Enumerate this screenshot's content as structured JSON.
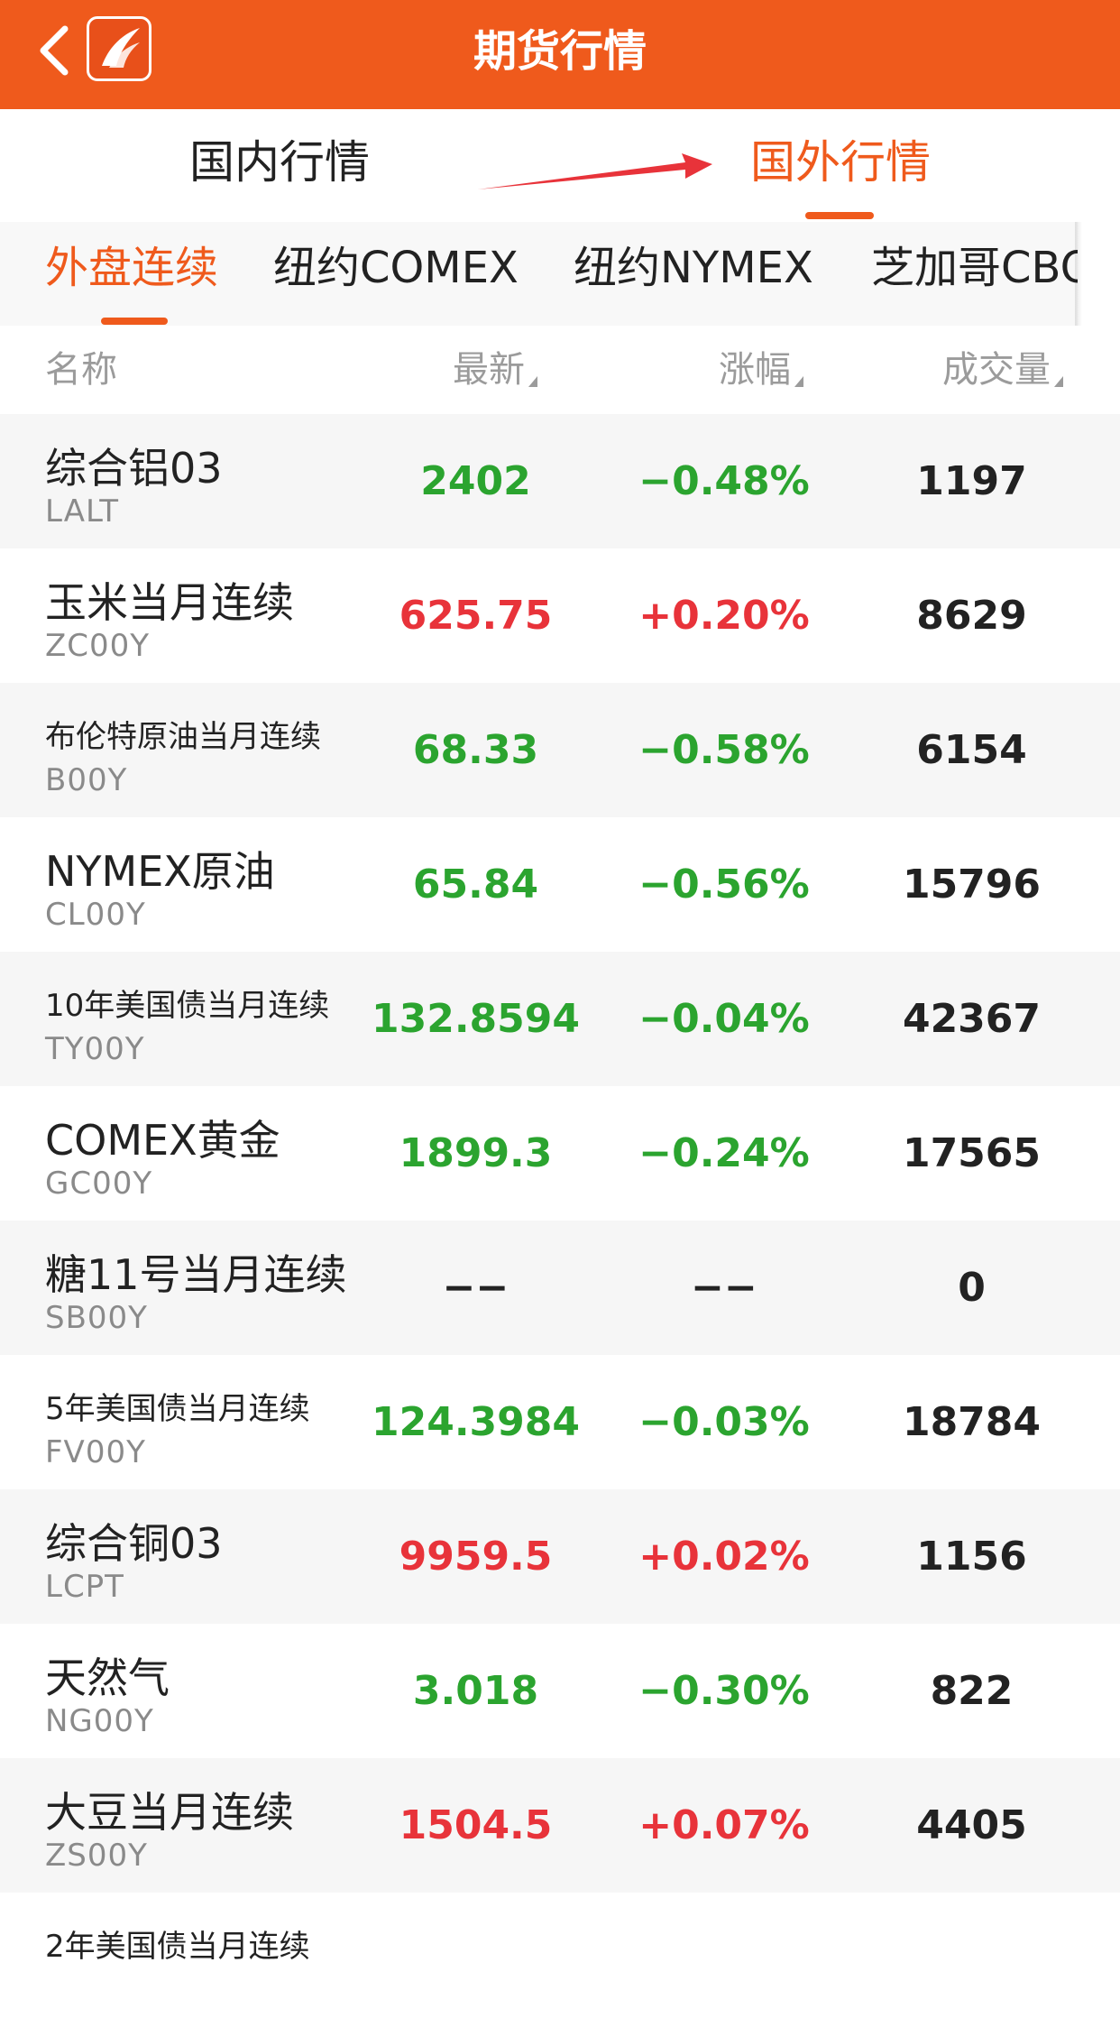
{
  "header": {
    "title": "期货行情"
  },
  "region_tabs": [
    {
      "label": "国内行情",
      "active": false
    },
    {
      "label": "国外行情",
      "active": true
    }
  ],
  "exchange_tabs": [
    {
      "label": "外盘连续",
      "active": true
    },
    {
      "label": "纽约COMEX",
      "active": false
    },
    {
      "label": "纽约NYMEX",
      "active": false
    },
    {
      "label": "芝加哥CBOT",
      "active": false
    }
  ],
  "columns": {
    "name": "名称",
    "latest": "最新",
    "change": "涨幅",
    "volume": "成交量"
  },
  "colors": {
    "accent": "#ef5a1c",
    "up": "#e8333a",
    "down": "#2ba42f"
  },
  "rows": [
    {
      "name": "综合铝03",
      "code": "LALT",
      "latest": "2402",
      "change": "−0.48%",
      "volume": "1197",
      "trend": "down"
    },
    {
      "name": "玉米当月连续",
      "code": "ZC00Y",
      "latest": "625.75",
      "change": "+0.20%",
      "volume": "8629",
      "trend": "up"
    },
    {
      "name": "布伦特原油当月连续",
      "code": "B00Y",
      "latest": "68.33",
      "change": "−0.58%",
      "volume": "6154",
      "trend": "down"
    },
    {
      "name": "NYMEX原油",
      "code": "CL00Y",
      "latest": "65.84",
      "change": "−0.56%",
      "volume": "15796",
      "trend": "down"
    },
    {
      "name": "10年美国债当月连续",
      "code": "TY00Y",
      "latest": "132.8594",
      "change": "−0.04%",
      "volume": "42367",
      "trend": "down"
    },
    {
      "name": "COMEX黄金",
      "code": "GC00Y",
      "latest": "1899.3",
      "change": "−0.24%",
      "volume": "17565",
      "trend": "down"
    },
    {
      "name": "糖11号当月连续",
      "code": "SB00Y",
      "latest": "−−",
      "change": "−−",
      "volume": "0",
      "trend": "flat"
    },
    {
      "name": "5年美国债当月连续",
      "code": "FV00Y",
      "latest": "124.3984",
      "change": "−0.03%",
      "volume": "18784",
      "trend": "down"
    },
    {
      "name": "综合铜03",
      "code": "LCPT",
      "latest": "9959.5",
      "change": "+0.02%",
      "volume": "1156",
      "trend": "up"
    },
    {
      "name": "天然气",
      "code": "NG00Y",
      "latest": "3.018",
      "change": "−0.30%",
      "volume": "822",
      "trend": "down"
    },
    {
      "name": "大豆当月连续",
      "code": "ZS00Y",
      "latest": "1504.5",
      "change": "+0.07%",
      "volume": "4405",
      "trend": "up"
    },
    {
      "name": "2年美国债当月连续",
      "code": "",
      "latest": "",
      "change": "",
      "volume": "",
      "trend": "flat"
    }
  ]
}
